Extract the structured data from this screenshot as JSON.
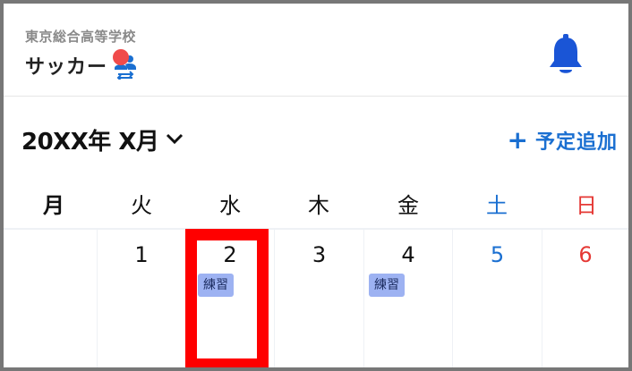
{
  "header": {
    "school_name": "東京総合高等学校",
    "team_name": "サッカー"
  },
  "calendar": {
    "month_label": "20XX年 X月",
    "add_plus": "+",
    "add_label": "予定追加",
    "weekdays": [
      "月",
      "火",
      "水",
      "木",
      "金",
      "土",
      "日"
    ],
    "days": [
      {
        "num": "",
        "event": ""
      },
      {
        "num": "1",
        "event": ""
      },
      {
        "num": "2",
        "event": "練習"
      },
      {
        "num": "3",
        "event": ""
      },
      {
        "num": "4",
        "event": "練習"
      },
      {
        "num": "5",
        "event": ""
      },
      {
        "num": "6",
        "event": ""
      }
    ]
  },
  "colors": {
    "accent": "#1a6fd1",
    "saturday": "#1a6fd1",
    "sunday": "#e53935",
    "event_bg": "#9db2f2",
    "notification_dot": "#f04b4b",
    "highlight": "#ff0000"
  },
  "icons": {
    "team_switch": "people-swap-icon",
    "notifications": "bell-icon",
    "month_dropdown": "chevron-down-icon"
  }
}
